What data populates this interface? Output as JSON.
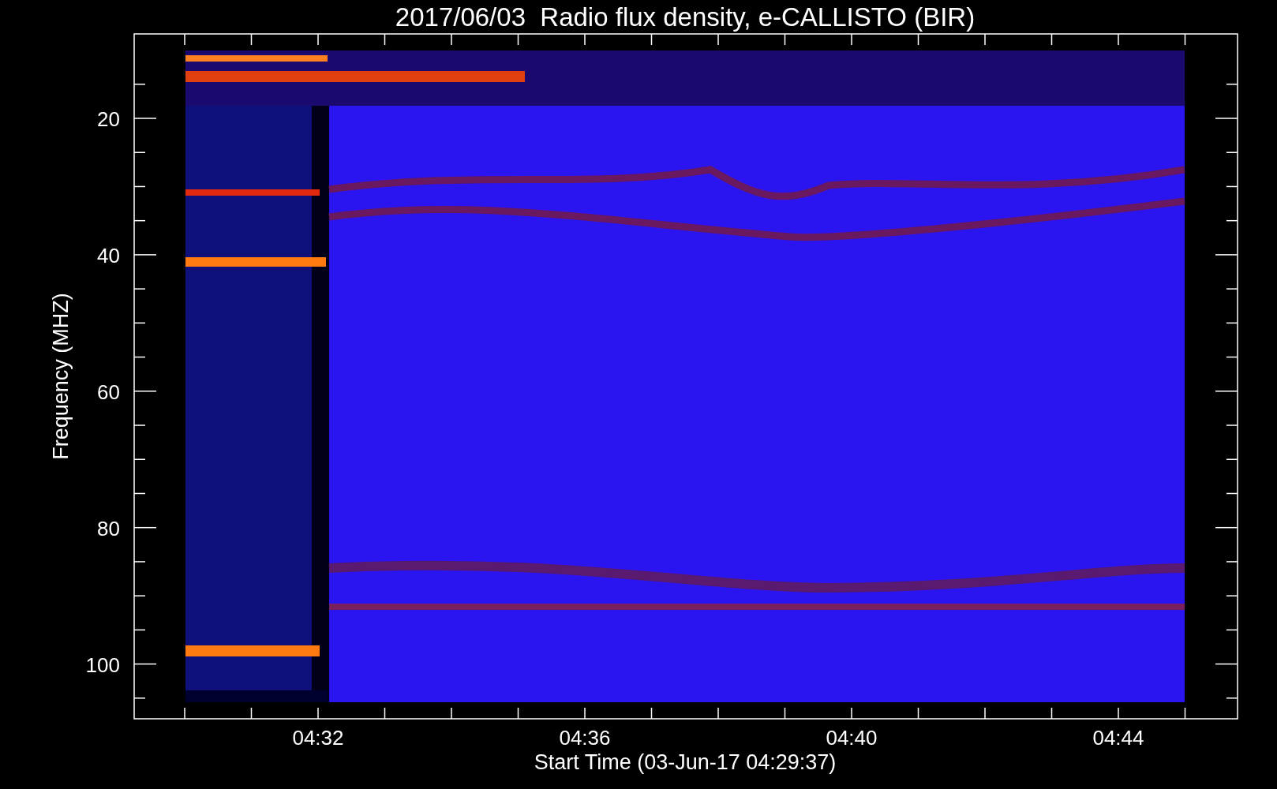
{
  "title": "2017/06/03  Radio flux density, e-CALLISTO (BIR)",
  "ylabel": "Frequency (MHZ)",
  "xlabel": "Start Time (03-Jun-17 04:29:37)",
  "yticks": [
    "20",
    "40",
    "60",
    "80",
    "100"
  ],
  "xticks": [
    "04:32",
    "04:36",
    "04:40",
    "04:44"
  ],
  "spectrogram": {
    "kind": "picture"
  }
}
